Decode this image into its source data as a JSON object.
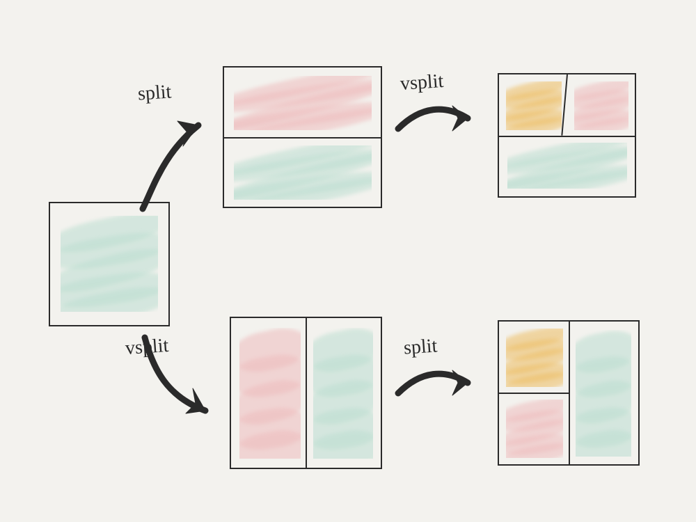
{
  "labels": {
    "split_top": "split",
    "vsplit_top": "vsplit",
    "vsplit_bottom": "vsplit",
    "split_bottom": "split"
  },
  "colors": {
    "green": "#bcded1",
    "pink": "#eebcbd",
    "gold": "#edbd62",
    "ink": "#2a2a2a",
    "paper": "#f3f2ee"
  },
  "diagram": {
    "root": {
      "panes": [
        {
          "fill": "green"
        }
      ]
    },
    "top_path": {
      "step1_op": "split",
      "step1_result": {
        "layout": "h-split",
        "panes": [
          {
            "fill": "pink"
          },
          {
            "fill": "green"
          }
        ]
      },
      "step2_op": "vsplit",
      "step2_result": {
        "layout": "h-split",
        "panes": [
          {
            "layout": "v-split",
            "panes": [
              {
                "fill": "gold"
              },
              {
                "fill": "pink"
              }
            ]
          },
          {
            "fill": "green"
          }
        ]
      }
    },
    "bottom_path": {
      "step1_op": "vsplit",
      "step1_result": {
        "layout": "v-split",
        "panes": [
          {
            "fill": "pink"
          },
          {
            "fill": "green"
          }
        ]
      },
      "step2_op": "split",
      "step2_result": {
        "layout": "v-split",
        "panes": [
          {
            "layout": "h-split",
            "panes": [
              {
                "fill": "gold"
              },
              {
                "fill": "pink"
              }
            ]
          },
          {
            "fill": "green"
          }
        ]
      }
    }
  }
}
